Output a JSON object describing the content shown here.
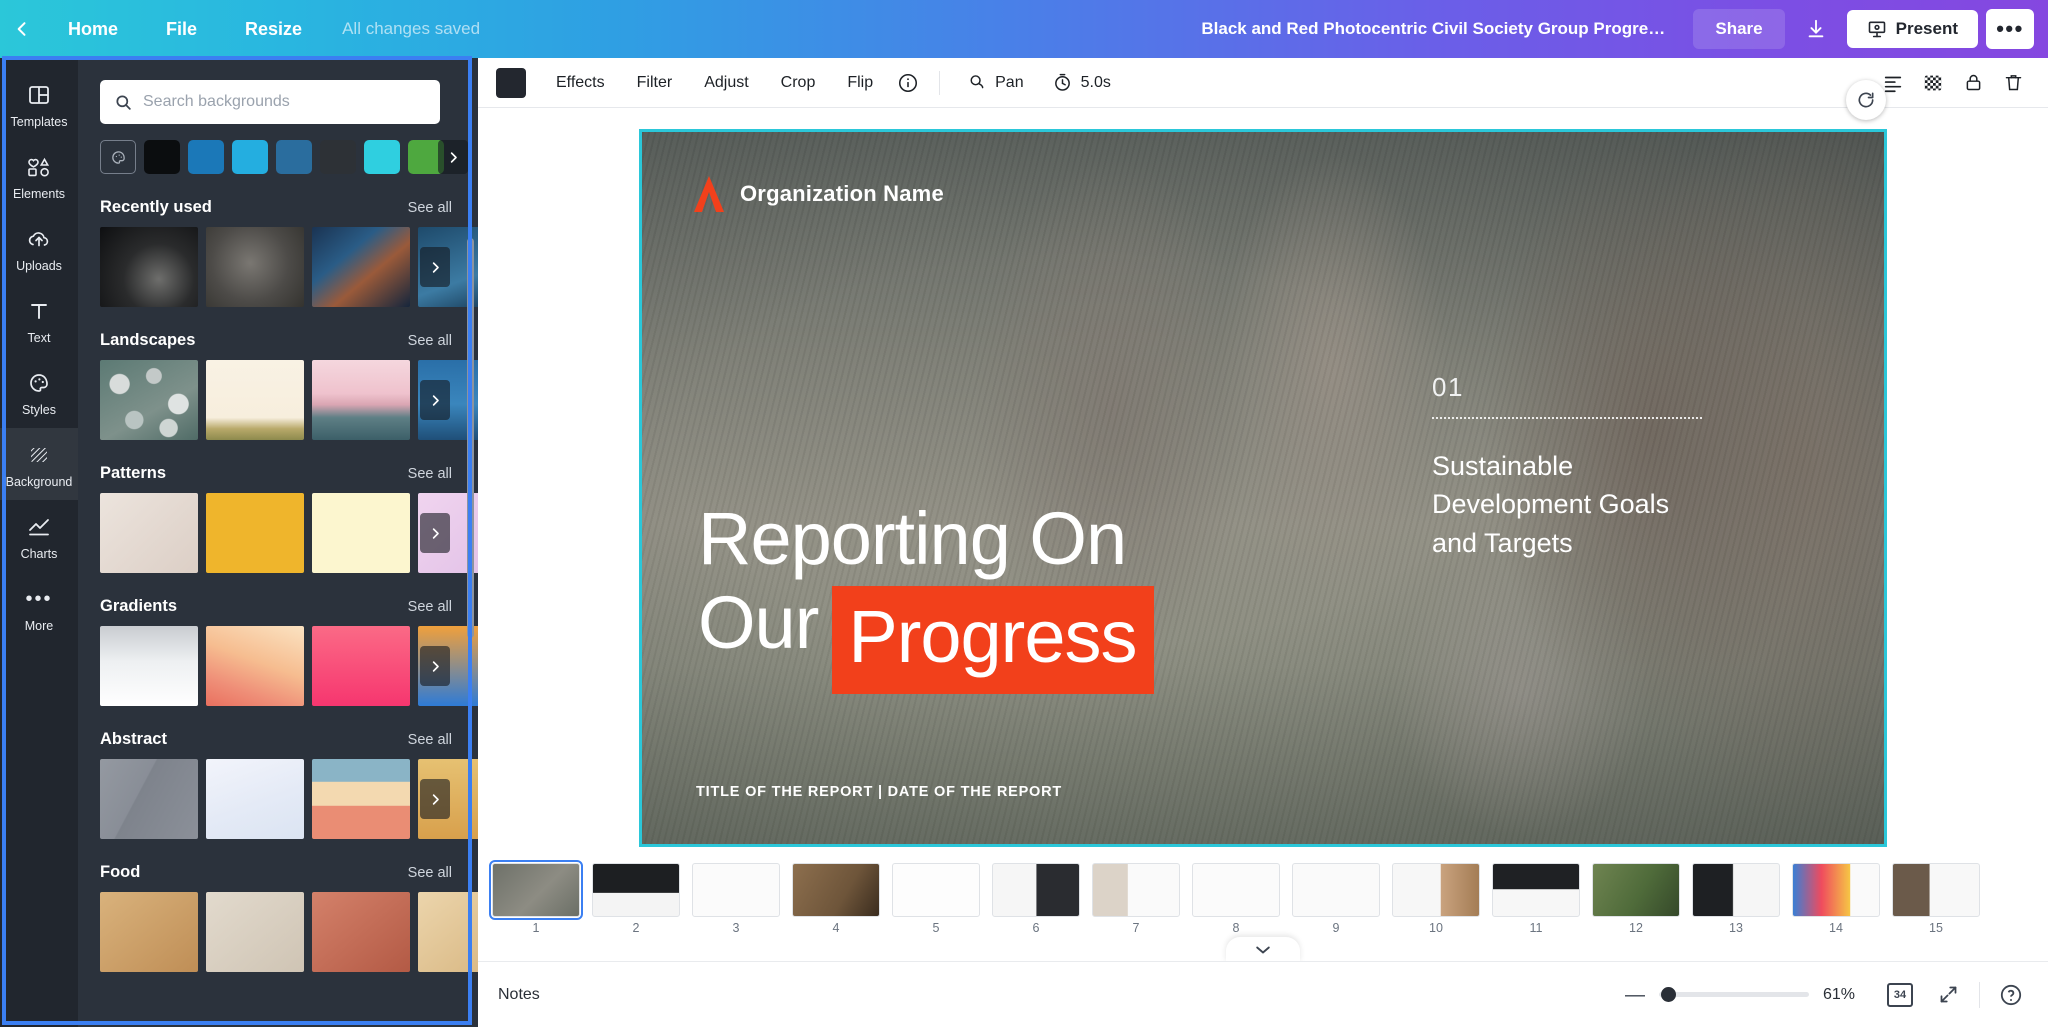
{
  "header": {
    "back_icon": "chevron-left-icon",
    "menu": [
      {
        "label": "Home"
      },
      {
        "label": "File"
      },
      {
        "label": "Resize"
      }
    ],
    "save_status": "All changes saved",
    "document_title": "Black and Red Photocentric Civil Society Group Progress Re...",
    "share_label": "Share",
    "download_icon": "download-icon",
    "present_label": "Present",
    "present_icon": "present-screen-icon",
    "more_label": "•••",
    "gradient_start": "#2bc7d9",
    "gradient_end": "#8547e0"
  },
  "rail": {
    "items": [
      {
        "label": "Templates",
        "icon": "templates-icon",
        "active": false
      },
      {
        "label": "Elements",
        "icon": "elements-icon",
        "active": false
      },
      {
        "label": "Uploads",
        "icon": "uploads-cloud-icon",
        "active": false
      },
      {
        "label": "Text",
        "icon": "text-icon",
        "active": false
      },
      {
        "label": "Styles",
        "icon": "styles-palette-icon",
        "active": false
      },
      {
        "label": "Background",
        "icon": "background-hatch-icon",
        "active": true
      },
      {
        "label": "Charts",
        "icon": "charts-line-icon",
        "active": false
      },
      {
        "label": "More",
        "icon": "more-dots-icon",
        "active": false
      }
    ]
  },
  "panel": {
    "search": {
      "placeholder": "Search backgrounds",
      "value": "",
      "icon": "search-icon"
    },
    "color_picker_icon": "color-palette-icon",
    "swatches": [
      "#0b0d0f",
      "#1b78b8",
      "#24aee0",
      "#2a6d9e",
      "#2d3136",
      "#2fcfe0",
      "#4ea83f"
    ],
    "swatch_next_icon": "chevron-right-icon",
    "see_all_label": "See all",
    "sections": [
      {
        "title": "Recently used",
        "thumbs": [
          "#14161a",
          "#4a4a48",
          "#1b3654",
          "#2b4c6d"
        ]
      },
      {
        "title": "Landscapes",
        "thumbs": [
          "#8d9a9d",
          "#f7efe0",
          "#e7b9c4",
          "#2f5f86"
        ]
      },
      {
        "title": "Patterns",
        "thumbs": [
          "#e6ddd6",
          "#efb52c",
          "#fcf6cf",
          "#e6c9e4"
        ]
      },
      {
        "title": "Gradients",
        "thumbs": [
          "#f0f1f3",
          "#f4c193",
          "#f64c84",
          "#2e7bd6"
        ]
      },
      {
        "title": "Abstract",
        "thumbs": [
          "#8a8f98",
          "#e9edf7",
          "#eb9a80",
          "#d8b86a"
        ]
      },
      {
        "title": "Food",
        "thumbs": [
          "#caa36b",
          "#d7cfc2",
          "#c4705a",
          "#e0c49a"
        ]
      }
    ]
  },
  "toolbar": {
    "swatch_color": "#23272f",
    "items": [
      {
        "label": "Effects"
      },
      {
        "label": "Filter"
      },
      {
        "label": "Adjust"
      },
      {
        "label": "Crop"
      },
      {
        "label": "Flip"
      }
    ],
    "info_icon": "info-circle-icon",
    "pan_label": "Pan",
    "pan_icon": "pan-hand-icon",
    "duration_label": "5.0s",
    "duration_icon": "timer-icon",
    "position_icon": "position-icon",
    "transparency_icon": "transparency-icon",
    "lock_icon": "lock-icon",
    "delete_icon": "trash-icon"
  },
  "slide": {
    "organization_name": "Organization Name",
    "logo_icon": "brand-logo-icon",
    "headline_line1": "Reporting On",
    "headline_word_our": "Our",
    "headline_word_highlight": "Progress",
    "highlight_color": "#f2401b",
    "side_number": "01",
    "side_text": "Sustainable Development Goals and Targets",
    "footer_caption": "TITLE OF THE REPORT  |  DATE OF THE REPORT",
    "rotate_icon": "rotate-icon",
    "selection_color": "#2bc7d9"
  },
  "filmstrip": {
    "collapse_icon": "chevron-down-icon",
    "slides": [
      {
        "number": "1",
        "selected": true
      },
      {
        "number": "2",
        "selected": false
      },
      {
        "number": "3",
        "selected": false
      },
      {
        "number": "4",
        "selected": false
      },
      {
        "number": "5",
        "selected": false
      },
      {
        "number": "6",
        "selected": false
      },
      {
        "number": "7",
        "selected": false
      },
      {
        "number": "8",
        "selected": false
      },
      {
        "number": "9",
        "selected": false
      },
      {
        "number": "10",
        "selected": false
      },
      {
        "number": "11",
        "selected": false
      },
      {
        "number": "12",
        "selected": false
      },
      {
        "number": "13",
        "selected": false
      },
      {
        "number": "14",
        "selected": false
      },
      {
        "number": "15",
        "selected": false
      }
    ]
  },
  "bottombar": {
    "notes_label": "Notes",
    "zoom_minus": "—",
    "zoom_value": "61%",
    "page_count": "34",
    "grid_icon": "grid-pages-icon",
    "fullscreen_icon": "fullscreen-icon",
    "help_icon": "help-circle-icon"
  }
}
